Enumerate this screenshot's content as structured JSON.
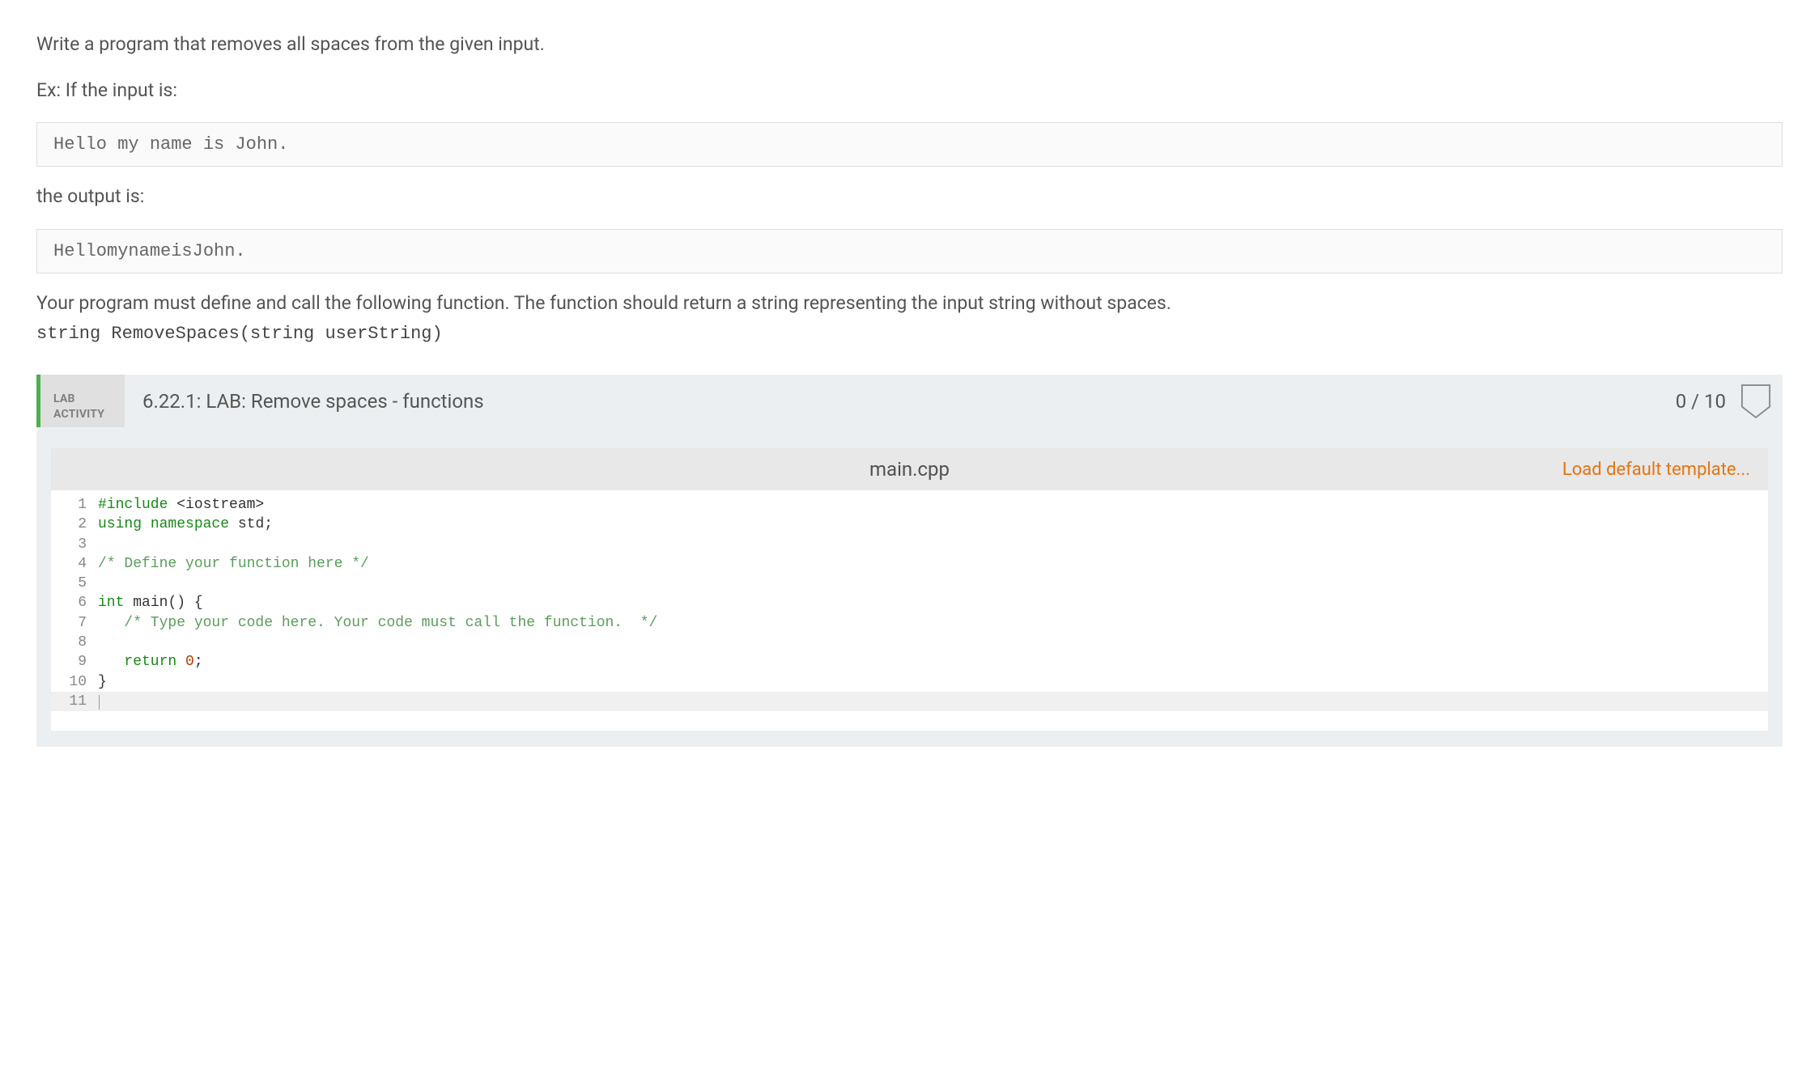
{
  "instructions": {
    "line1": "Write a program that removes all spaces from the given input.",
    "line2": "Ex: If the input is:",
    "example_input": "Hello my name is John.",
    "line3": "the output is:",
    "example_output": "HellomynameisJohn.",
    "line4": "Your program must define and call the following function. The function should return a string representing the input string without spaces.",
    "func_sig": "string RemoveSpaces(string userString)"
  },
  "lab": {
    "tag_line1": "LAB",
    "tag_line2": "ACTIVITY",
    "title": "6.22.1: LAB: Remove spaces - functions",
    "score": "0 / 10"
  },
  "editor": {
    "filename": "main.cpp",
    "load_link": "Load default template...",
    "lines": [
      {
        "n": "1",
        "tokens": [
          {
            "t": "#include ",
            "c": "tok-pp"
          },
          {
            "t": "<iostream>",
            "c": "tok-inc"
          }
        ]
      },
      {
        "n": "2",
        "tokens": [
          {
            "t": "using ",
            "c": "tok-kw"
          },
          {
            "t": "namespace ",
            "c": "tok-kw"
          },
          {
            "t": "std",
            "c": "tok-id"
          },
          {
            "t": ";",
            "c": "tok-punc"
          }
        ]
      },
      {
        "n": "3",
        "tokens": [
          {
            "t": "",
            "c": ""
          }
        ]
      },
      {
        "n": "4",
        "tokens": [
          {
            "t": "/* Define your function here */",
            "c": "tok-cmt"
          }
        ]
      },
      {
        "n": "5",
        "tokens": [
          {
            "t": "",
            "c": ""
          }
        ]
      },
      {
        "n": "6",
        "tokens": [
          {
            "t": "int ",
            "c": "tok-kw"
          },
          {
            "t": "main",
            "c": "tok-id"
          },
          {
            "t": "() {",
            "c": "tok-punc"
          }
        ]
      },
      {
        "n": "7",
        "tokens": [
          {
            "t": "   ",
            "c": ""
          },
          {
            "t": "/* Type your code here. Your code must call the function.  */",
            "c": "tok-cmt"
          }
        ]
      },
      {
        "n": "8",
        "tokens": [
          {
            "t": "",
            "c": ""
          }
        ]
      },
      {
        "n": "9",
        "tokens": [
          {
            "t": "   ",
            "c": ""
          },
          {
            "t": "return ",
            "c": "tok-kw"
          },
          {
            "t": "0",
            "c": "tok-num"
          },
          {
            "t": ";",
            "c": "tok-punc"
          }
        ]
      },
      {
        "n": "10",
        "tokens": [
          {
            "t": "}",
            "c": "tok-punc"
          }
        ]
      },
      {
        "n": "11",
        "tokens": [
          {
            "t": "",
            "c": ""
          }
        ],
        "active": true,
        "cursor": true
      }
    ]
  }
}
